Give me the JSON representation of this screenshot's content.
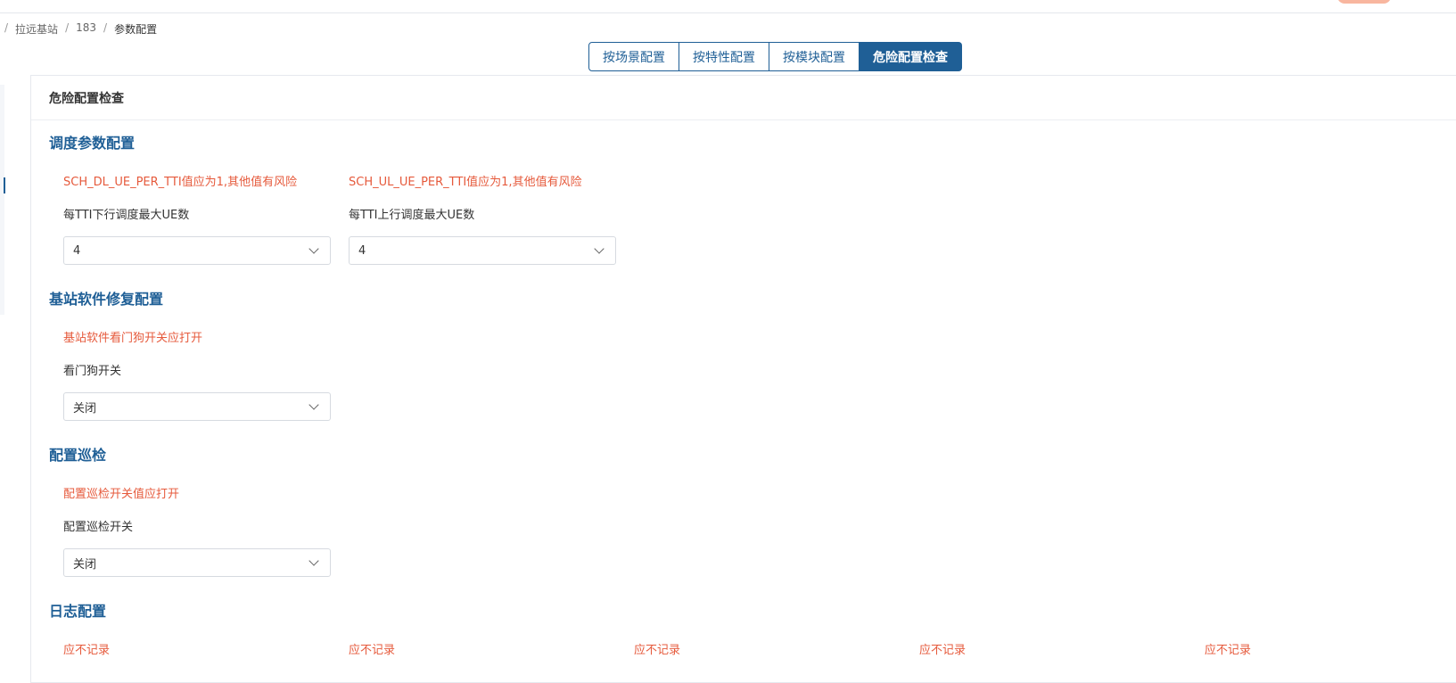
{
  "breadcrumb": {
    "items": [
      "拉远基站",
      "183",
      "参数配置"
    ]
  },
  "tabs": [
    {
      "label": "按场景配置",
      "active": false
    },
    {
      "label": "按特性配置",
      "active": false
    },
    {
      "label": "按模块配置",
      "active": false
    },
    {
      "label": "危险配置检查",
      "active": true
    }
  ],
  "card": {
    "title": "危险配置检查"
  },
  "sections": {
    "scheduling": {
      "title": "调度参数配置",
      "fields": [
        {
          "warning": "SCH_DL_UE_PER_TTI值应为1,其他值有风险",
          "label": "每TTI下行调度最大UE数",
          "value": "4"
        },
        {
          "warning": "SCH_UL_UE_PER_TTI值应为1,其他值有风险",
          "label": "每TTI上行调度最大UE数",
          "value": "4"
        }
      ]
    },
    "software_repair": {
      "title": "基站软件修复配置",
      "fields": [
        {
          "warning": "基站软件看门狗开关应打开",
          "label": "看门狗开关",
          "value": "关闭"
        }
      ]
    },
    "inspection": {
      "title": "配置巡检",
      "fields": [
        {
          "warning": "配置巡检开关值应打开",
          "label": "配置巡检开关",
          "value": "关闭"
        }
      ]
    },
    "log": {
      "title": "日志配置",
      "warnings": [
        "应不记录",
        "应不记录",
        "应不记录",
        "应不记录",
        "应不记录"
      ]
    }
  },
  "colors": {
    "accent": "#1f5f96",
    "warning": "#e65a3c"
  }
}
